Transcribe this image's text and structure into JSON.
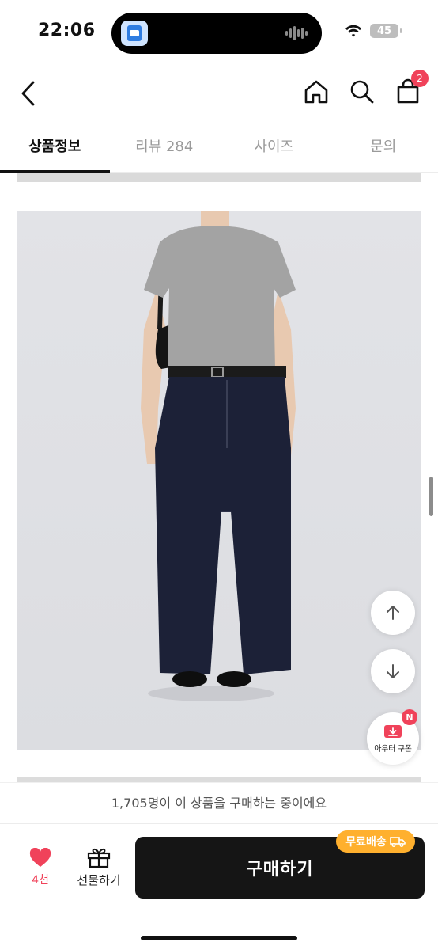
{
  "status_bar": {
    "time": "22:06",
    "battery": "45",
    "icons": [
      "app-icon",
      "audio-wave-icon",
      "wifi-icon",
      "battery-icon"
    ]
  },
  "nav": {
    "cart_count": "2",
    "icons": [
      "back-chevron-icon",
      "home-icon",
      "search-icon",
      "shopping-bag-icon"
    ]
  },
  "tabs": [
    {
      "label": "상품정보",
      "active": true
    },
    {
      "label": "리뷰 284",
      "active": false
    },
    {
      "label": "사이즈",
      "active": false
    },
    {
      "label": "문의",
      "active": false
    }
  ],
  "floating": {
    "coupon_label": "아우터 쿠폰",
    "coupon_badge": "N",
    "icons": [
      "arrow-up-icon",
      "arrow-down-icon",
      "coupon-download-icon"
    ]
  },
  "purchase_banner": "1,705명이 이 상품을 구매하는 중이에요",
  "bottom": {
    "like_count": "4천",
    "gift_label": "선물하기",
    "buy_label": "구매하기",
    "free_shipping": "무료배송",
    "icons": [
      "heart-icon",
      "gift-icon",
      "truck-icon"
    ]
  },
  "colors": {
    "accent": "#f0425a",
    "buy_button": "#151515",
    "free_shipping_badge": "#ffb02e",
    "image_background": "#e0e1e5"
  }
}
